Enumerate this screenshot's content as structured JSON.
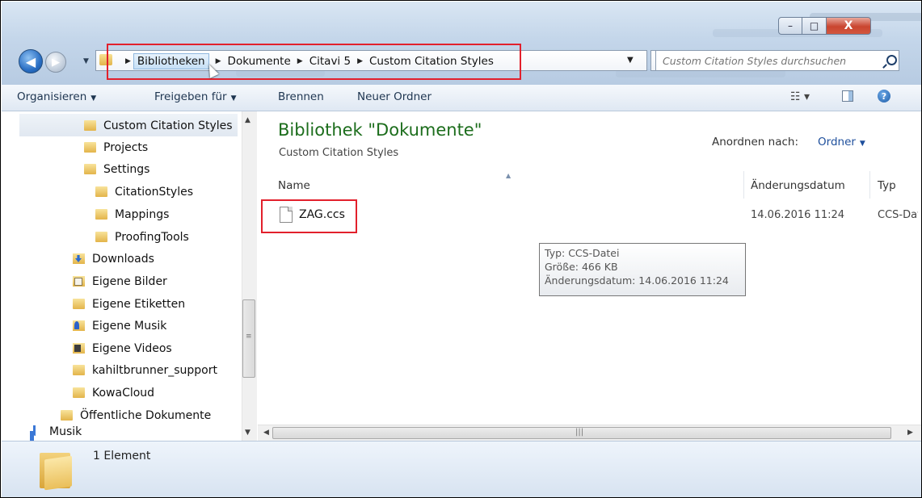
{
  "window": {
    "minimize_label": "–",
    "maximize_label": "□",
    "close_label": "X"
  },
  "address": {
    "crumbs": [
      "Bibliotheken",
      "Dokumente",
      "Citavi 5",
      "Custom Citation Styles"
    ],
    "search_placeholder": "Custom Citation Styles durchsuchen"
  },
  "toolbar": {
    "organize": "Organisieren",
    "share": "Freigeben für",
    "burn": "Brennen",
    "new_folder": "Neuer Ordner"
  },
  "nav": {
    "items": [
      {
        "label": "Custom Citation Styles",
        "icon": "folder"
      },
      {
        "label": "Projects",
        "icon": "folder"
      },
      {
        "label": "Settings",
        "icon": "folder"
      },
      {
        "label": "CitationStyles",
        "icon": "folder"
      },
      {
        "label": "Mappings",
        "icon": "folder"
      },
      {
        "label": "ProofingTools",
        "icon": "folder"
      },
      {
        "label": "Downloads",
        "icon": "download-folder"
      },
      {
        "label": "Eigene Bilder",
        "icon": "pictures-folder"
      },
      {
        "label": "Eigene Etiketten",
        "icon": "folder"
      },
      {
        "label": "Eigene Musik",
        "icon": "music-folder"
      },
      {
        "label": "Eigene Videos",
        "icon": "video-folder"
      },
      {
        "label": "kahiltbrunner_support",
        "icon": "folder"
      },
      {
        "label": "KowaCloud",
        "icon": "folder"
      },
      {
        "label": "Öffentliche Dokumente",
        "icon": "folder"
      },
      {
        "label": "Musik",
        "icon": "music-library"
      }
    ]
  },
  "content": {
    "library_title": "Bibliothek \"Dokumente\"",
    "library_subtitle": "Custom Citation Styles",
    "arrange_label": "Anordnen nach:",
    "arrange_value": "Ordner",
    "columns": {
      "name": "Name",
      "date": "Änderungsdatum",
      "type": "Typ"
    },
    "files": [
      {
        "name": "ZAG.ccs",
        "date": "14.06.2016 11:24",
        "type": "CCS-Datei"
      }
    ],
    "tooltip": {
      "type": "Typ: CCS-Datei",
      "size": "Größe: 466 KB",
      "date": "Änderungsdatum: 14.06.2016 11:24"
    }
  },
  "status": {
    "count": "1 Element"
  },
  "colors": {
    "accent_red": "#e2202c",
    "library_title": "#1c6d1c",
    "link_blue": "#1e4f9c"
  }
}
